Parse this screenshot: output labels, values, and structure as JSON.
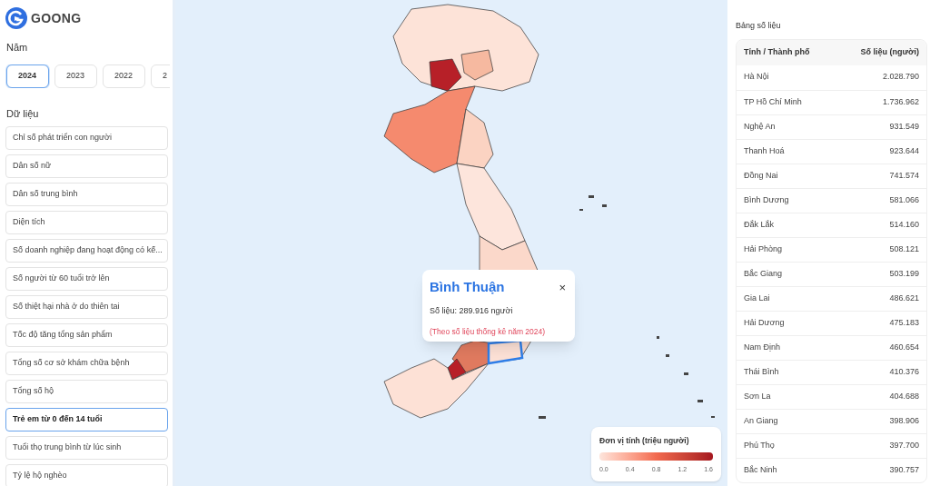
{
  "brand": "GOONG",
  "year_section": {
    "label": "Năm",
    "years": [
      {
        "label": "2024",
        "selected": true
      },
      {
        "label": "2023",
        "selected": false
      },
      {
        "label": "2022",
        "selected": false
      },
      {
        "label": "2",
        "selected": false
      }
    ]
  },
  "data_section": {
    "label": "Dữ liệu",
    "items": [
      {
        "label": "Chỉ số phát triển con người",
        "selected": false
      },
      {
        "label": "Dân số nữ",
        "selected": false
      },
      {
        "label": "Dân số trung bình",
        "selected": false
      },
      {
        "label": "Diện tích",
        "selected": false
      },
      {
        "label": "Số doanh nghiệp đang hoạt động có kế...",
        "selected": false
      },
      {
        "label": "Số người từ 60 tuổi trở lên",
        "selected": false
      },
      {
        "label": "Số thiệt hại nhà ở do thiên tai",
        "selected": false
      },
      {
        "label": "Tốc độ tăng tổng sản phẩm",
        "selected": false
      },
      {
        "label": "Tổng số cơ sở khám chữa bệnh",
        "selected": false
      },
      {
        "label": "Tổng số hộ",
        "selected": false
      },
      {
        "label": "Trẻ em từ 0 đến 14 tuổi",
        "selected": true
      },
      {
        "label": "Tuổi thọ trung bình từ lúc sinh",
        "selected": false
      },
      {
        "label": "Tỷ lệ hộ nghèo",
        "selected": false
      }
    ]
  },
  "popup": {
    "title": "Bình Thuận",
    "value": "Số liệu: 289.916 người",
    "note": "(Theo số liệu thống kê năm 2024)",
    "close": "×"
  },
  "legend": {
    "title": "Đơn vị tính (triệu người)",
    "ticks": [
      "0.0",
      "0.4",
      "0.8",
      "1.2",
      "1.6"
    ]
  },
  "table": {
    "title": "Bảng số liệu",
    "columns": [
      "Tỉnh / Thành phố",
      "Số liệu (người)"
    ],
    "rows": [
      [
        "Hà Nội",
        "2.028.790"
      ],
      [
        "TP Hồ Chí Minh",
        "1.736.962"
      ],
      [
        "Nghệ An",
        "931.549"
      ],
      [
        "Thanh Hoá",
        "923.644"
      ],
      [
        "Đồng Nai",
        "741.574"
      ],
      [
        "Bình Dương",
        "581.066"
      ],
      [
        "Đắk Lắk",
        "514.160"
      ],
      [
        "Hải Phòng",
        "508.121"
      ],
      [
        "Bắc Giang",
        "503.199"
      ],
      [
        "Gia Lai",
        "486.621"
      ],
      [
        "Hải Dương",
        "475.183"
      ],
      [
        "Nam Định",
        "460.654"
      ],
      [
        "Thái Bình",
        "410.376"
      ],
      [
        "Sơn La",
        "404.688"
      ],
      [
        "An Giang",
        "398.906"
      ],
      [
        "Phú Thọ",
        "397.700"
      ],
      [
        "Bắc Ninh",
        "390.757"
      ]
    ]
  }
}
